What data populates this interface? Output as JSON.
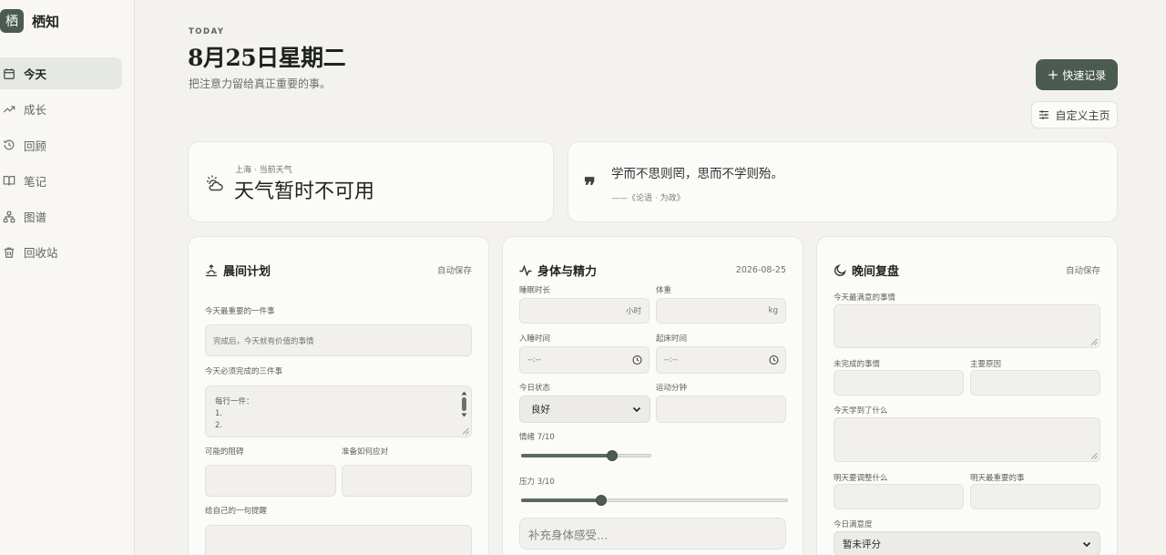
{
  "app": {
    "logo_char": "栖",
    "name": "栖知"
  },
  "sidebar": {
    "items": [
      {
        "label": "今天",
        "icon": "calendar-icon",
        "active": true
      },
      {
        "label": "成长",
        "icon": "trend-icon"
      },
      {
        "label": "回顾",
        "icon": "history-icon"
      },
      {
        "label": "笔记",
        "icon": "book-icon"
      },
      {
        "label": "图谱",
        "icon": "graph-icon"
      },
      {
        "label": "回收站",
        "icon": "trash-icon"
      }
    ]
  },
  "header": {
    "kicker": "TODAY",
    "title": "8月25日星期二",
    "subtitle": "把注意力留给真正重要的事。",
    "quick_record": "快速记录",
    "customize": "自定义主页"
  },
  "weather": {
    "location": "上海 · 当前天气",
    "status": "天气暂时不可用"
  },
  "quote": {
    "text": "学而不思则罔，思而不学则殆。",
    "source": "——《论语 · 为政》"
  },
  "morning": {
    "title": "晨间计划",
    "meta": "自动保存",
    "most_important_label": "今天最重要的一件事",
    "most_important_placeholder": "完成后，今天就有价值的事情",
    "three_tasks_label": "今天必须完成的三件事",
    "three_tasks_lines": [
      "每行一件：",
      "1.",
      "2."
    ],
    "obstacles_label": "可能的阻碍",
    "response_label": "准备如何应对",
    "reminder_label": "给自己的一句提醒"
  },
  "body": {
    "title": "身体与精力",
    "date": "2026-08-25",
    "sleep_label": "睡眠时长",
    "sleep_unit": "小时",
    "weight_label": "体重",
    "weight_unit": "kg",
    "bedtime_label": "入睡时间",
    "waketime_label": "起床时间",
    "time_placeholder": "--:--",
    "status_label": "今日状态",
    "status_value": "良好",
    "exercise_label": "运动分钟",
    "mood_label": "情绪 7/10",
    "mood_value": 7,
    "stress_label": "压力 3/10",
    "stress_value": 3,
    "scale_max": 10,
    "note_placeholder": "补充身体感受…"
  },
  "evening": {
    "title": "晚间复盘",
    "meta": "自动保存",
    "satisfied_label": "今天最满意的事情",
    "unfinished_label": "未完成的事情",
    "reason_label": "主要原因",
    "learned_label": "今天学到了什么",
    "adjust_label": "明天要调整什么",
    "tomorrow_label": "明天最重要的事",
    "rating_label": "今日满意度",
    "rating_value": "暂未评分"
  }
}
